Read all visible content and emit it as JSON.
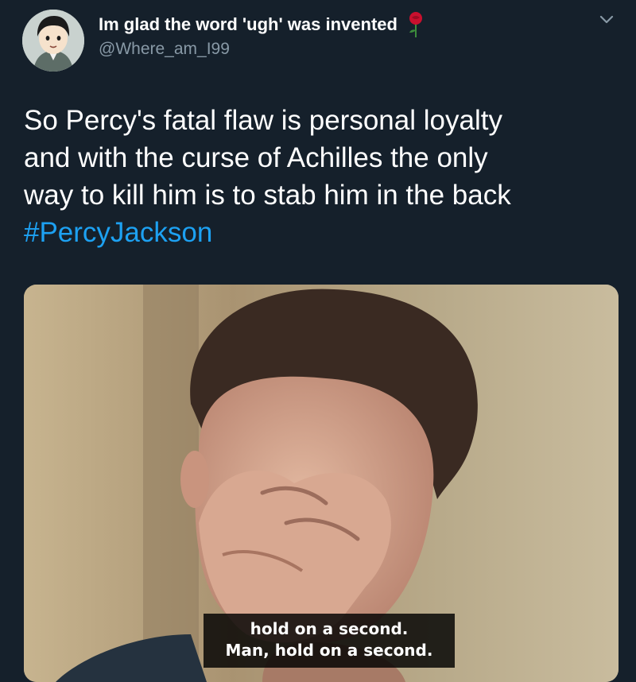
{
  "tweet": {
    "display_name": "Im glad the word 'ugh' was invented",
    "handle": "@Where_am_I99",
    "text_lines": [
      "So Percy's fatal flaw is personal loyalty",
      "and with the curse of Achilles the only",
      "way to kill him is to stab him in the back"
    ],
    "hashtag": "#PercyJackson",
    "icons": {
      "name_emoji": "rose-icon",
      "menu": "chevron-down-icon"
    },
    "colors": {
      "background": "#15202b",
      "text": "#ffffff",
      "secondary_text": "#8899a6",
      "link": "#1da1f2"
    }
  },
  "media": {
    "subtitle_lines": [
      "hold on a second.",
      "Man, hold on a second."
    ]
  }
}
